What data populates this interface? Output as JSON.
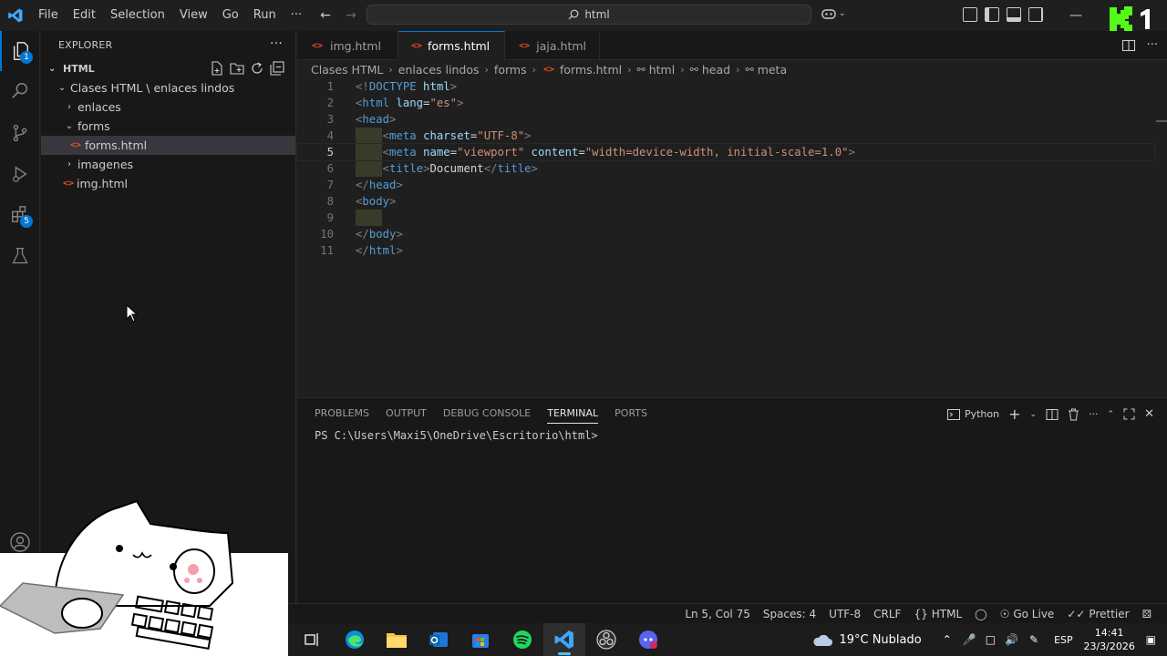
{
  "menu": {
    "items": [
      "File",
      "Edit",
      "Selection",
      "View",
      "Go",
      "Run",
      "···"
    ]
  },
  "command_center": {
    "text": "html"
  },
  "sidebar": {
    "title": "EXPLORER",
    "section": "HTML",
    "tree": [
      {
        "label": "Clases HTML \\ enlaces lindos",
        "type": "folder-open"
      },
      {
        "label": "enlaces",
        "type": "folder"
      },
      {
        "label": "forms",
        "type": "folder-open"
      },
      {
        "label": "forms.html",
        "type": "file"
      },
      {
        "label": "imagenes",
        "type": "folder"
      },
      {
        "label": "img.html",
        "type": "file"
      }
    ]
  },
  "activity_badges": {
    "explorer": "1",
    "extensions": "5"
  },
  "tabs": [
    {
      "label": "img.html"
    },
    {
      "label": "forms.html"
    },
    {
      "label": "jaja.html"
    }
  ],
  "breadcrumb": [
    "Clases HTML",
    "enlaces lindos",
    "forms",
    "forms.html",
    "html",
    "head",
    "meta"
  ],
  "editor": {
    "line_numbers": [
      "1",
      "2",
      "3",
      "4",
      "5",
      "6",
      "7",
      "8",
      "9",
      "10",
      "11"
    ],
    "current_line": 5
  },
  "panel": {
    "tabs": [
      "PROBLEMS",
      "OUTPUT",
      "DEBUG CONSOLE",
      "TERMINAL",
      "PORTS"
    ],
    "active_tab": "TERMINAL",
    "shell": "Python",
    "terminal_prompt": "PS C:\\Users\\Maxi5\\OneDrive\\Escritorio\\html>"
  },
  "statusbar": {
    "position": "Ln 5, Col 75",
    "spaces": "Spaces: 4",
    "encoding": "UTF-8",
    "eol": "CRLF",
    "language": "HTML",
    "golive": "Go Live",
    "prettier": "Prettier"
  },
  "taskbar": {
    "weather": "19°C  Nublado",
    "lang": "ESP",
    "time": "14:41",
    "date": "23/3/2026"
  },
  "colors": {
    "accent": "#0078d4",
    "tag": "#569cd6",
    "attr": "#9cdcfe",
    "string": "#ce9178",
    "brand_kick": "#53fc18"
  }
}
